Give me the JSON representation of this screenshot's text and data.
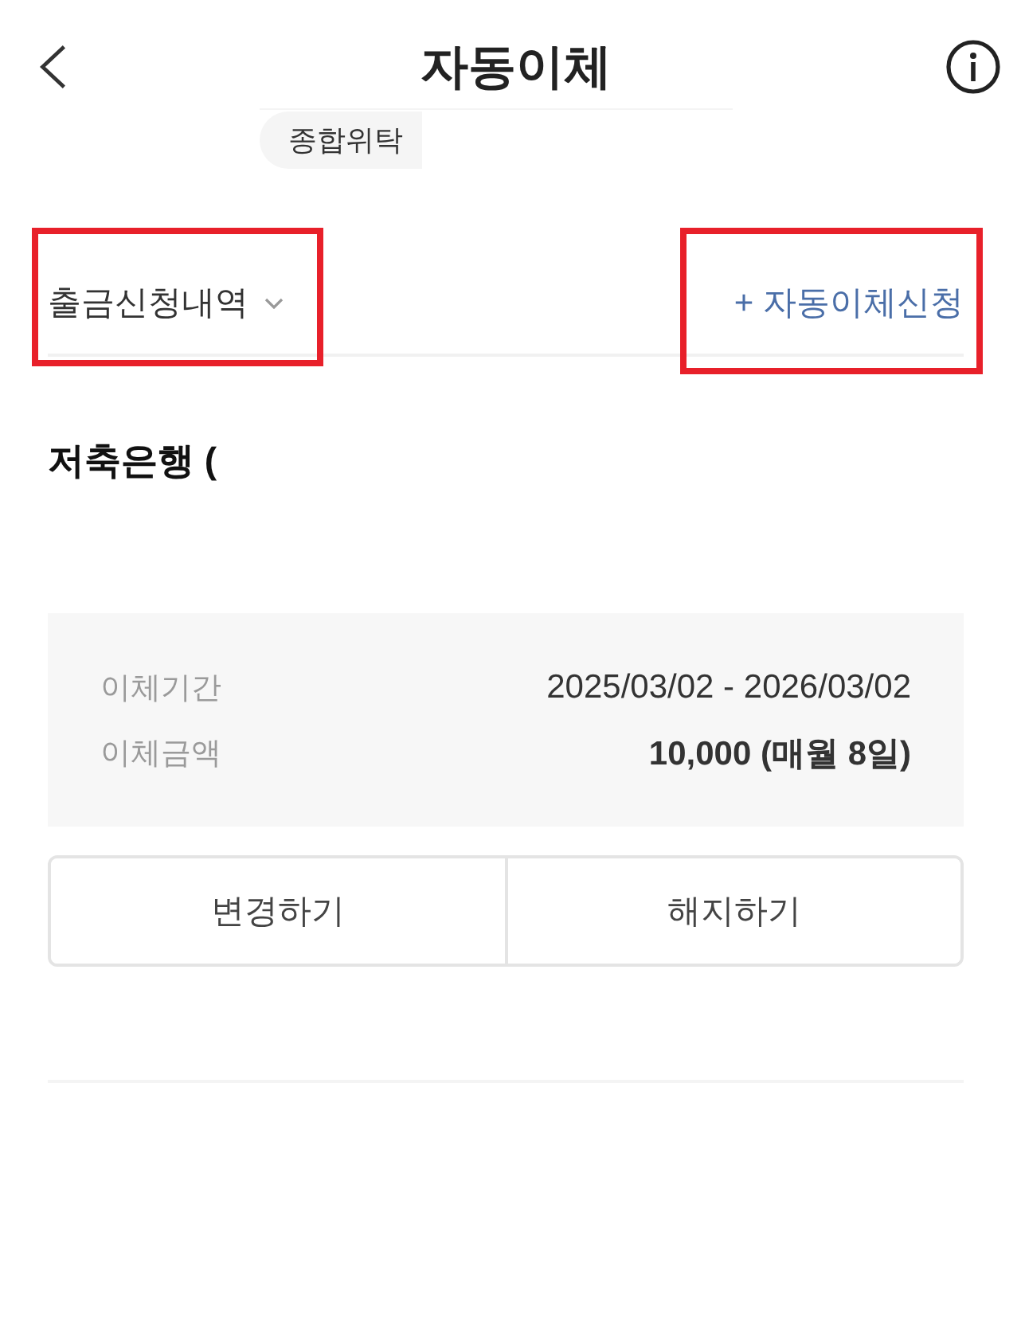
{
  "header": {
    "title": "자동이체"
  },
  "account_tabs": [
    {
      "label": "종합위탁",
      "selected": true
    }
  ],
  "toolbar": {
    "filter": {
      "label": "출금신청내역",
      "highlighted": true
    },
    "apply_link": {
      "label": "+ 자동이체신청",
      "highlighted": true
    }
  },
  "transfer": {
    "bank": "저축은행 (",
    "details": [
      {
        "label": "이체기간",
        "value": "2025/03/02 - 2026/03/02",
        "emphasis": false
      },
      {
        "label": "이체금액",
        "value": "10,000 (매월 8일)",
        "emphasis": true
      }
    ],
    "buttons": [
      {
        "label": "변경하기"
      },
      {
        "label": "해지하기"
      }
    ]
  }
}
